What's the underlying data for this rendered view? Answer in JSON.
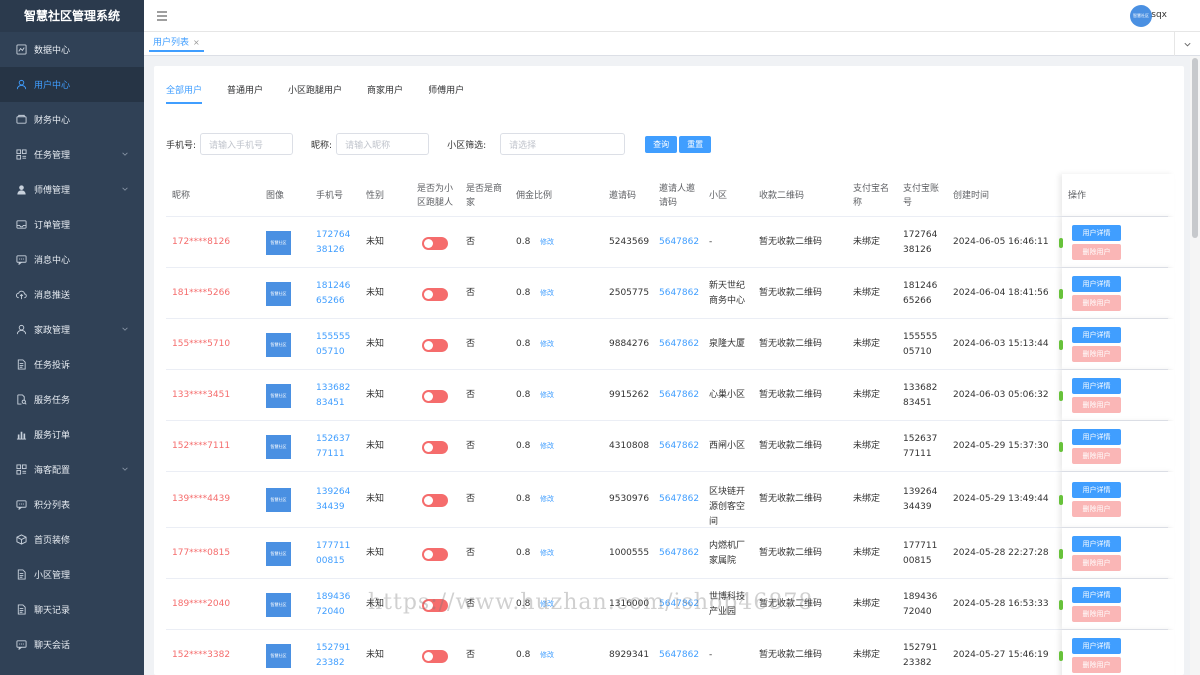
{
  "app": {
    "title": "智慧社区管理系统",
    "user": "sqx",
    "avatar_text": "智慧社区"
  },
  "sidebar": {
    "items": [
      {
        "label": "数据中心",
        "icon": "chart-icon"
      },
      {
        "label": "用户中心",
        "icon": "user-icon",
        "active": true
      },
      {
        "label": "财务中心",
        "icon": "wallet-icon"
      },
      {
        "label": "任务管理",
        "icon": "grid-icon",
        "expandable": true
      },
      {
        "label": "师傅管理",
        "icon": "worker-icon",
        "expandable": true
      },
      {
        "label": "订单管理",
        "icon": "inbox-icon"
      },
      {
        "label": "消息中心",
        "icon": "message-icon"
      },
      {
        "label": "消息推送",
        "icon": "cloud-upload-icon"
      },
      {
        "label": "家政管理",
        "icon": "user-icon",
        "expandable": true
      },
      {
        "label": "任务投诉",
        "icon": "document-icon"
      },
      {
        "label": "服务任务",
        "icon": "document-search-icon"
      },
      {
        "label": "服务订单",
        "icon": "bar-chart-icon"
      },
      {
        "label": "海客配置",
        "icon": "grid-icon",
        "expandable": true
      },
      {
        "label": "积分列表",
        "icon": "message-icon"
      },
      {
        "label": "首页装修",
        "icon": "box-icon"
      },
      {
        "label": "小区管理",
        "icon": "document-icon"
      },
      {
        "label": "聊天记录",
        "icon": "document-icon"
      },
      {
        "label": "聊天会话",
        "icon": "message-icon"
      }
    ]
  },
  "tagsbar": {
    "active_tag": "用户列表",
    "close": "×"
  },
  "tabs": [
    "全部用户",
    "普通用户",
    "小区跑腿用户",
    "商家用户",
    "师傅用户"
  ],
  "filters": {
    "phone_label": "手机号:",
    "phone_placeholder": "请输入手机号",
    "nick_label": "昵称:",
    "nick_placeholder": "请输入昵称",
    "community_label": "小区筛选:",
    "community_placeholder": "请选择",
    "search_btn": "查询",
    "reset_btn": "重置"
  },
  "table": {
    "headers": {
      "nick": "昵称",
      "image": "图像",
      "phone": "手机号",
      "gender": "性别",
      "runner": "是否为小区跑腿人",
      "merchant": "是否是商家",
      "commission": "佣金比例",
      "invite": "邀请码",
      "inviter": "邀请人邀请码",
      "community": "小区",
      "qrcode": "收款二维码",
      "alipay_name": "支付宝名称",
      "alipay_account": "支付宝账号",
      "created": "创建时间",
      "ops": "操作"
    },
    "edit_label": "修改",
    "detail_btn": "用户详情",
    "delete_btn": "删除用户",
    "thumb_text": "智慧社区",
    "rows": [
      {
        "nick": "172****8126",
        "phone": "17276438126",
        "gender": "未知",
        "merchant": "否",
        "commission": "0.8",
        "invite": "5243569",
        "inviter": "5647862",
        "community": "-",
        "qrcode": "暂无收款二维码",
        "alipay_name": "未绑定",
        "alipay_account": "17276438126",
        "created": "2024-06-05 16:46:11"
      },
      {
        "nick": "181****5266",
        "phone": "18124665266",
        "gender": "未知",
        "merchant": "否",
        "commission": "0.8",
        "invite": "2505775",
        "inviter": "5647862",
        "community": "新天世纪商务中心",
        "qrcode": "暂无收款二维码",
        "alipay_name": "未绑定",
        "alipay_account": "18124665266",
        "created": "2024-06-04 18:41:56"
      },
      {
        "nick": "155****5710",
        "phone": "15555505710",
        "gender": "未知",
        "merchant": "否",
        "commission": "0.8",
        "invite": "9884276",
        "inviter": "5647862",
        "community": "泉隆大厦",
        "qrcode": "暂无收款二维码",
        "alipay_name": "未绑定",
        "alipay_account": "15555505710",
        "created": "2024-06-03 15:13:44"
      },
      {
        "nick": "133****3451",
        "phone": "13368283451",
        "gender": "未知",
        "merchant": "否",
        "commission": "0.8",
        "invite": "9915262",
        "inviter": "5647862",
        "community": "心巢小区",
        "qrcode": "暂无收款二维码",
        "alipay_name": "未绑定",
        "alipay_account": "13368283451",
        "created": "2024-06-03 05:06:32"
      },
      {
        "nick": "152****7111",
        "phone": "15263777111",
        "gender": "未知",
        "merchant": "否",
        "commission": "0.8",
        "invite": "4310808",
        "inviter": "5647862",
        "community": "西闸小区",
        "qrcode": "暂无收款二维码",
        "alipay_name": "未绑定",
        "alipay_account": "15263777111",
        "created": "2024-05-29 15:37:30"
      },
      {
        "nick": "139****4439",
        "phone": "13926434439",
        "gender": "未知",
        "merchant": "否",
        "commission": "0.8",
        "invite": "9530976",
        "inviter": "5647862",
        "community": "区块链开源创客空间",
        "qrcode": "暂无收款二维码",
        "alipay_name": "未绑定",
        "alipay_account": "13926434439",
        "created": "2024-05-29 13:49:44"
      },
      {
        "nick": "177****0815",
        "phone": "17771100815",
        "gender": "未知",
        "merchant": "否",
        "commission": "0.8",
        "invite": "1000555",
        "inviter": "5647862",
        "community": "内燃机厂家属院",
        "qrcode": "暂无收款二维码",
        "alipay_name": "未绑定",
        "alipay_account": "17771100815",
        "created": "2024-05-28 22:27:28"
      },
      {
        "nick": "189****2040",
        "phone": "18943672040",
        "gender": "未知",
        "merchant": "否",
        "commission": "0.8",
        "invite": "1316000",
        "inviter": "5647862",
        "community": "世博科技产业园",
        "qrcode": "暂无收款二维码",
        "alipay_name": "未绑定",
        "alipay_account": "18943672040",
        "created": "2024-05-28 16:53:33"
      },
      {
        "nick": "152****3382",
        "phone": "15279123382",
        "gender": "未知",
        "merchant": "否",
        "commission": "0.8",
        "invite": "8929341",
        "inviter": "5647862",
        "community": "-",
        "qrcode": "暂无收款二维码",
        "alipay_name": "未绑定",
        "alipay_account": "15279123382",
        "created": "2024-05-27 15:46:19"
      }
    ]
  },
  "watermark": "https://www.huzhan.com/ishop46878"
}
